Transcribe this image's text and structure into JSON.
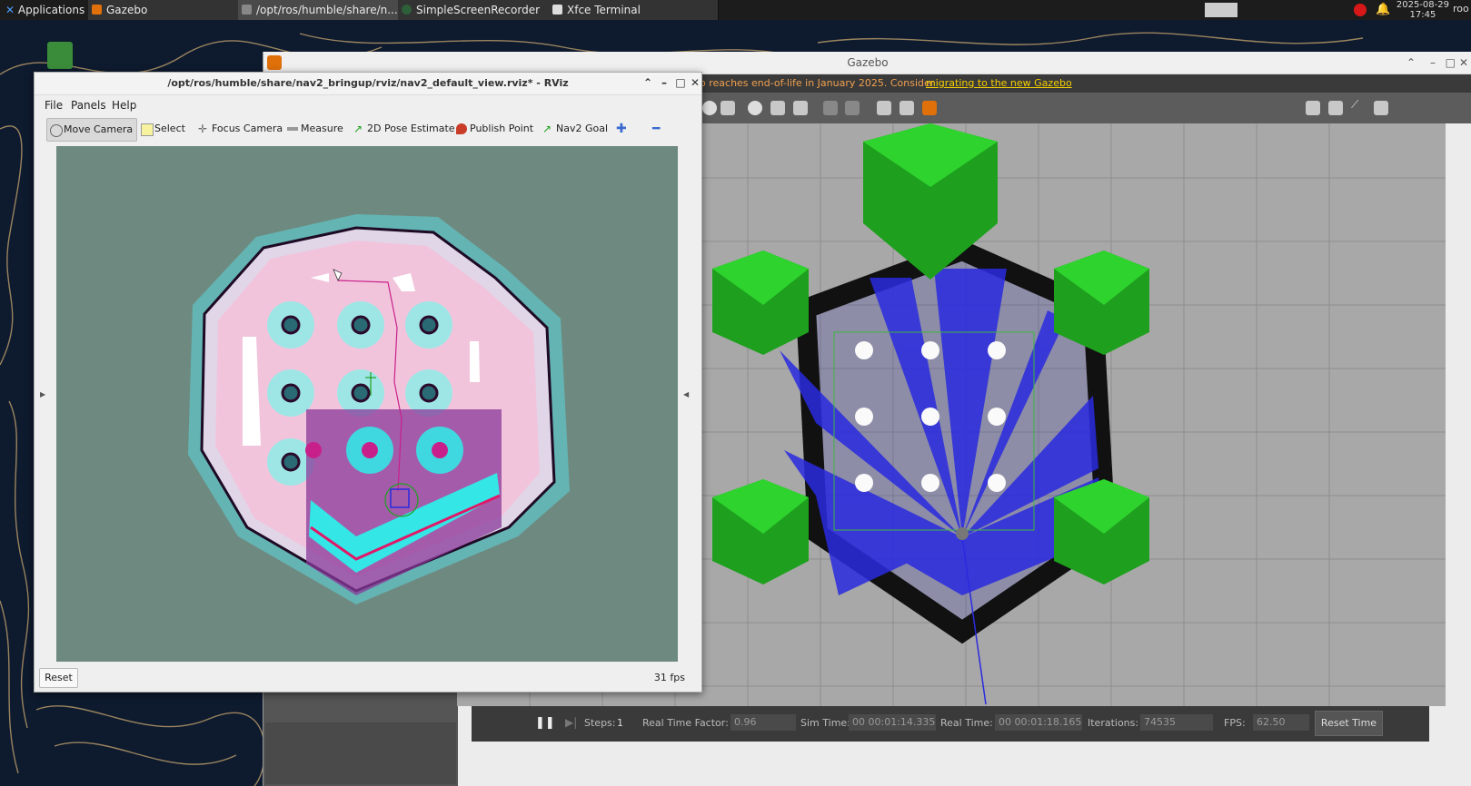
{
  "taskbar": {
    "applications": "Applications",
    "tasks": [
      {
        "label": "Gazebo"
      },
      {
        "label": "/opt/ros/humble/share/n..."
      },
      {
        "label": "SimpleScreenRecorder"
      },
      {
        "label": "Xfce Terminal"
      }
    ],
    "clock_date": "2025-08-29",
    "clock_time": "17:45",
    "user": "roo"
  },
  "gazebo": {
    "title": "Gazebo",
    "notice_text": "o reaches end-of-life in January 2025. Consider",
    "notice_link": "migrating to the new Gazebo",
    "sim": {
      "steps_label": "Steps:",
      "steps_value": "1",
      "rtf_label": "Real Time Factor:",
      "rtf_value": "0.96",
      "sim_time_label": "Sim Time:",
      "sim_time_value": "00 00:01:14.335",
      "real_time_label": "Real Time:",
      "real_time_value": "00 00:01:18.165",
      "iterations_label": "Iterations:",
      "iterations_value": "74535",
      "fps_label": "FPS:",
      "fps_value": "62.50",
      "reset_time": "Reset Time"
    }
  },
  "rviz": {
    "title": "/opt/ros/humble/share/nav2_bringup/rviz/nav2_default_view.rviz* - RViz",
    "menu": [
      "File",
      "Panels",
      "Help"
    ],
    "tools": [
      "Move Camera",
      "Select",
      "Focus Camera",
      "Measure",
      "2D Pose Estimate",
      "Publish Point",
      "Nav2 Goal"
    ],
    "reset": "Reset",
    "fps": "31 fps"
  },
  "colors": {
    "accent_orange": "#f0a050",
    "link_yellow": "#f6d100",
    "pillar_green": "#1ec41e",
    "laser_blue": "#2a2ae0",
    "map_teal": "#6e8a80"
  }
}
